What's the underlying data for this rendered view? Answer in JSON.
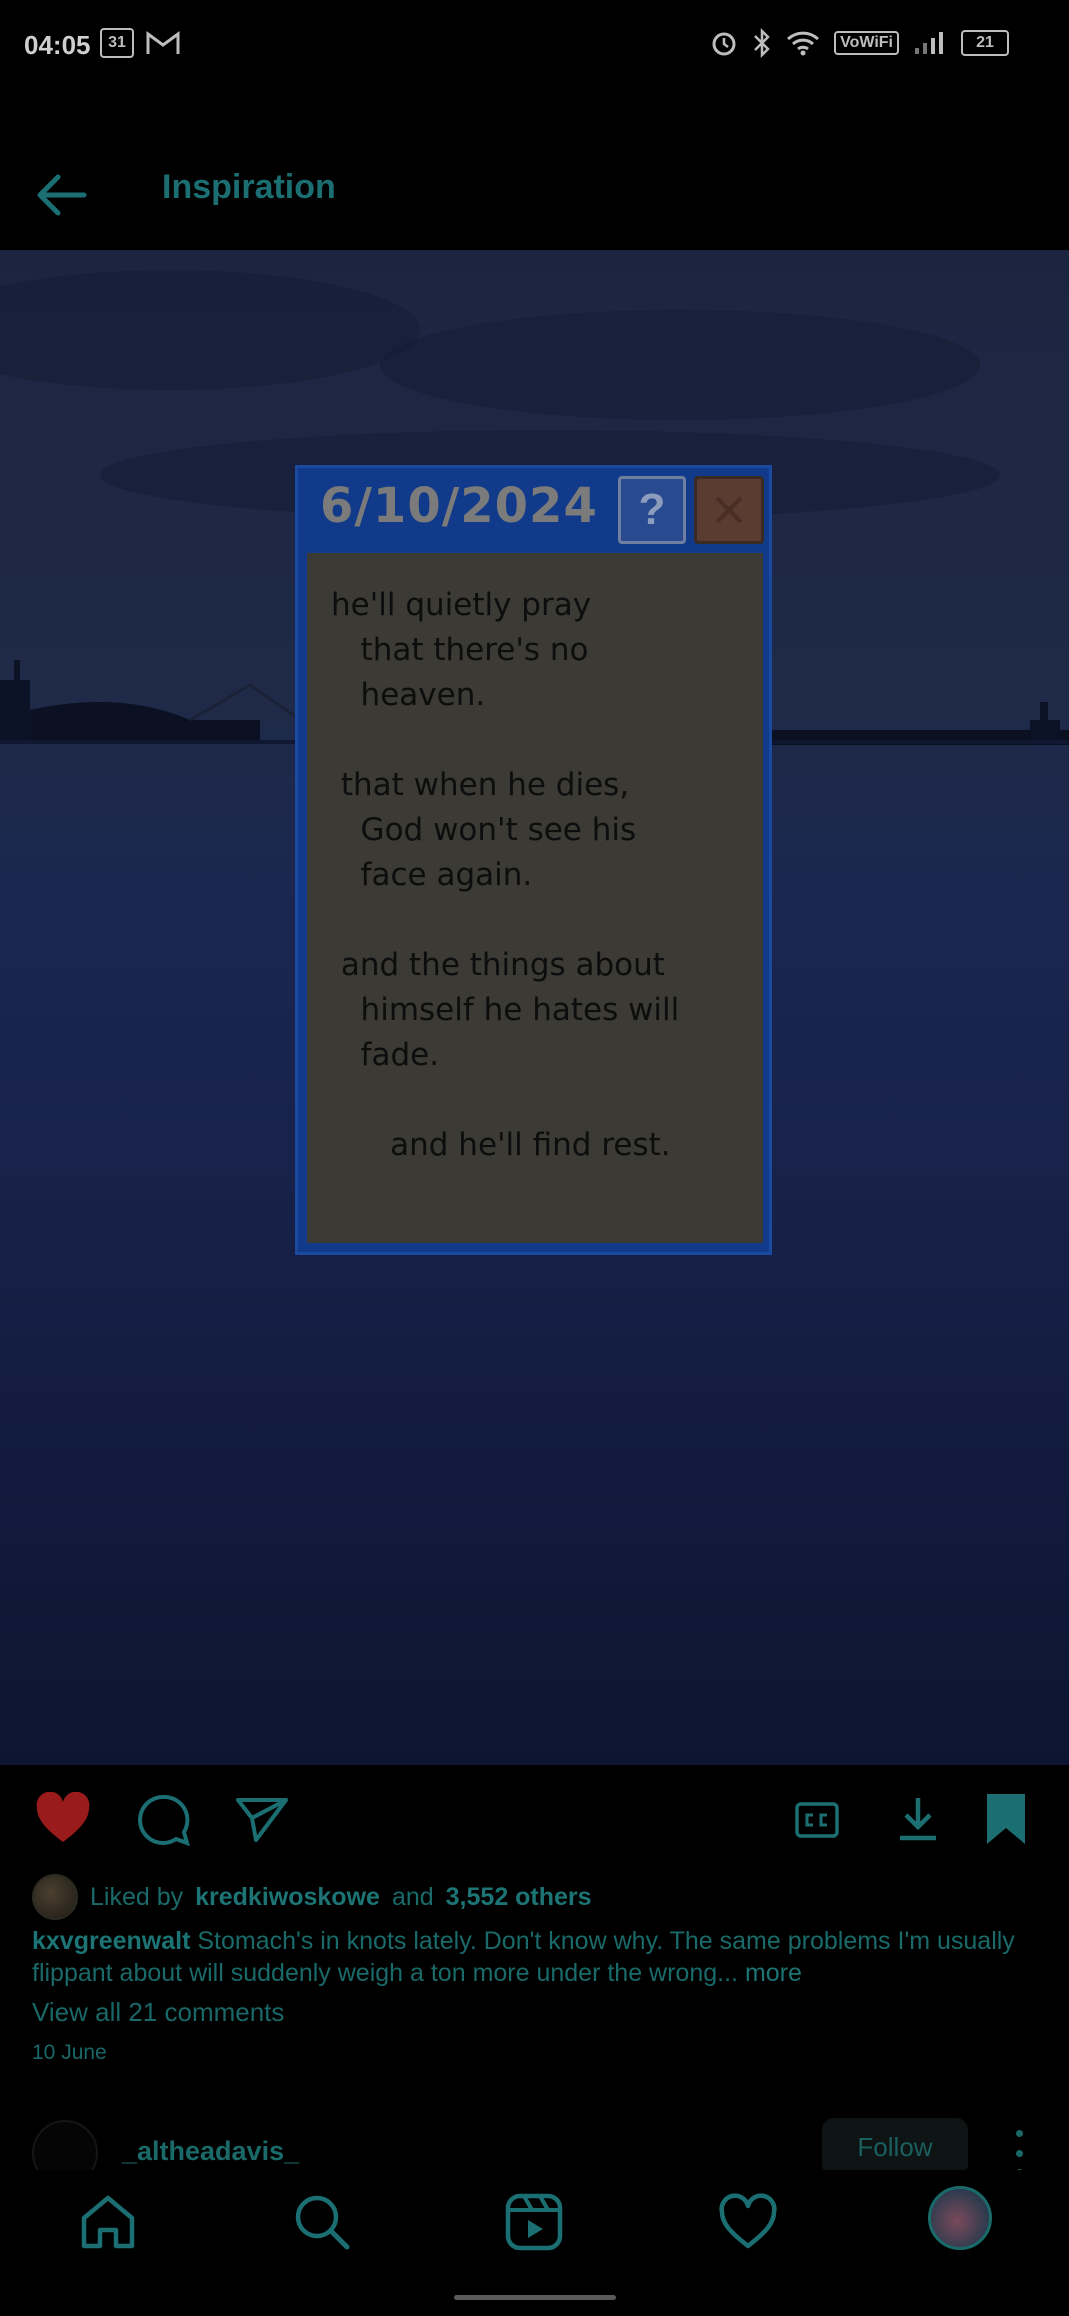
{
  "status_bar": {
    "time": "04:05",
    "calendar_badge": "31",
    "vowifi": "VoWiFi",
    "battery": "21",
    "icons": [
      "calendar-icon",
      "gmail-icon",
      "alarm-icon",
      "bluetooth-icon",
      "wifi-icon",
      "signal-icon",
      "battery-icon"
    ]
  },
  "header": {
    "title": "Inspiration",
    "back_icon": "back-arrow-icon"
  },
  "post": {
    "image": {
      "dialog_title": "6/10/2024",
      "help_label": "?",
      "poem": "he'll quietly pray\n   that there's no\n   heaven.\n\n that when he dies,\n   God won't see his\n   face again.\n\n and the things about\n   himself he hates will\n   fade.\n\n      and he'll find rest."
    },
    "actions": [
      "heart-icon",
      "comment-icon",
      "share-icon",
      "captions-icon",
      "download-icon",
      "bookmark-icon"
    ],
    "liked_prefix": "Liked by",
    "liked_user": "kredkiwoskowe",
    "liked_and": "and",
    "liked_others": "3,552 others",
    "author": "kxvgreenwalt",
    "caption": "Stomach's in knots lately. Don't know why. The same problems I'm usually flippant about will suddenly weigh a ton more under the wrong...",
    "more_label": "more",
    "view_comments": "View all 21 comments",
    "date": "10 June"
  },
  "next_post": {
    "username": "_altheadavis_",
    "follow_label": "Follow"
  },
  "bottom_nav": [
    "home-icon",
    "search-icon",
    "reels-icon",
    "activity-heart-icon",
    "profile-avatar"
  ],
  "colors": {
    "accent": "#1b6f72",
    "like": "#9a1b1b",
    "bg": "#000000"
  }
}
